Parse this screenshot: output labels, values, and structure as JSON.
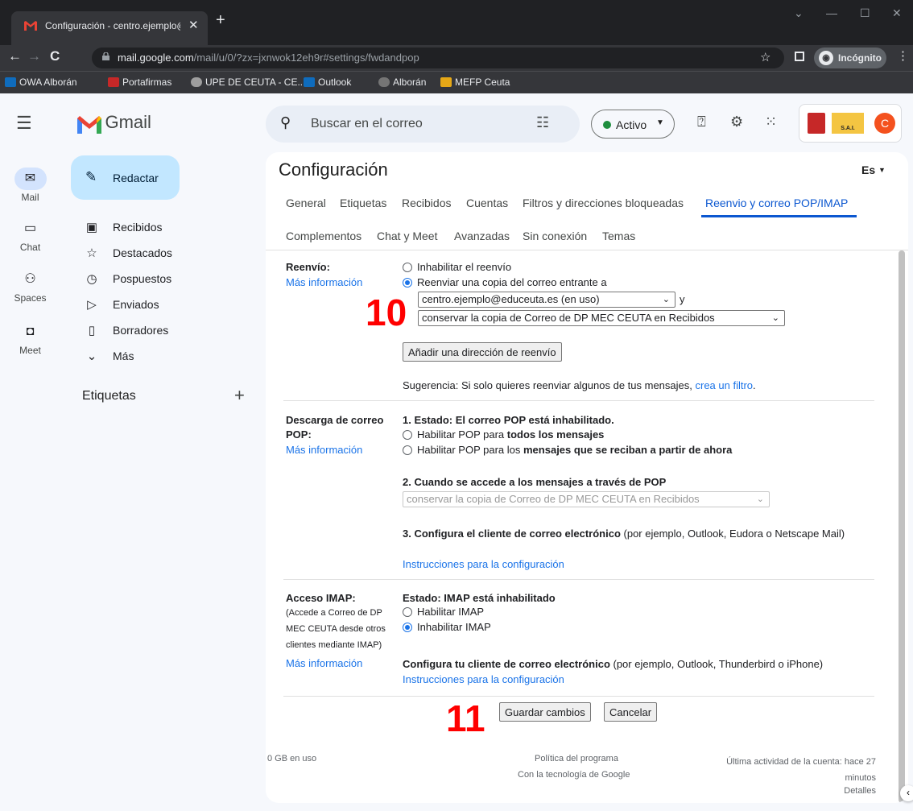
{
  "browser": {
    "tab_title": "Configuración - centro.ejemplo@",
    "url_host": "mail.google.com",
    "url_path": "/mail/u/0/?zx=jxnwok12eh9r#settings/fwdandpop",
    "incognito_label": "Incógnito",
    "bookmarks": [
      {
        "label": "OWA Alborán",
        "color": "#0f6cbd"
      },
      {
        "label": "Portafirmas",
        "color": "#c62828"
      },
      {
        "label": "UPE DE CEUTA - CE...",
        "color": "#9e9e9e"
      },
      {
        "label": "Outlook",
        "color": "#0f6cbd"
      },
      {
        "label": "Alborán",
        "color": "#9e9e9e"
      },
      {
        "label": "MEFP Ceuta",
        "color": "#e6a817"
      }
    ]
  },
  "rail": [
    {
      "label": "Mail"
    },
    {
      "label": "Chat"
    },
    {
      "label": "Spaces"
    },
    {
      "label": "Meet"
    }
  ],
  "app": {
    "name": "Gmail"
  },
  "compose_label": "Redactar",
  "nav": [
    {
      "label": "Recibidos",
      "icon": "inbox-icon"
    },
    {
      "label": "Destacados",
      "icon": "star-icon"
    },
    {
      "label": "Pospuestos",
      "icon": "clock-icon"
    },
    {
      "label": "Enviados",
      "icon": "send-icon"
    },
    {
      "label": "Borradores",
      "icon": "draft-icon"
    },
    {
      "label": "Más",
      "icon": "chevron-down-icon"
    }
  ],
  "labels_heading": "Etiquetas",
  "search_placeholder": "Buscar en el correo",
  "status_label": "Activo",
  "avatar_letter": "C",
  "org_logo_text": "S.A.I.",
  "settings": {
    "title": "Configuración",
    "lang": "Es",
    "tabs_row1": [
      "General",
      "Etiquetas",
      "Recibidos",
      "Cuentas",
      "Filtros y direcciones bloqueadas",
      "Reenvio y correo POP/IMAP"
    ],
    "tabs_row2": [
      "Complementos",
      "Chat y Meet",
      "Avanzadas",
      "Sin conexión",
      "Temas"
    ],
    "forwarding": {
      "label": "Reenvío:",
      "more_info": "Más información",
      "opt_disable": "Inhabilitar el reenvío",
      "opt_forward": "Reenviar una copia del correo entrante a",
      "address": "centro.ejemplo@educeuta.es (en uso)",
      "and": "y",
      "keep_option": "conservar la copia de Correo de DP MEC CEUTA en Recibidos",
      "add_button": "Añadir una dirección de reenvío",
      "tip": "Sugerencia: Si solo quieres reenviar algunos de tus mensajes,",
      "tip_link": "crea un filtro"
    },
    "pop": {
      "label": "Descarga de correo POP:",
      "more_info": "Más información",
      "status": "1. Estado: El correo POP está inhabilitado.",
      "opt_all_pre": "Habilitar POP para ",
      "opt_all_bold": "todos los mensajes",
      "opt_now_pre": "Habilitar POP para los ",
      "opt_now_bold": "mensajes que se reciban a partir de ahora",
      "access_heading": "2. Cuando se accede a los mensajes a través de POP",
      "access_select": "conservar la copia de Correo de DP MEC CEUTA en Recibidos",
      "config_bold": "3. Configura el cliente de correo electrónico",
      "config_rest": " (por ejemplo, Outlook, Eudora o Netscape Mail)",
      "instructions": "Instrucciones para la configuración"
    },
    "imap": {
      "label": "Acceso IMAP:",
      "desc": "(Accede a Correo de DP MEC CEUTA desde otros clientes mediante IMAP)",
      "more_info": "Más información",
      "status": "Estado: IMAP está inhabilitado",
      "opt_enable": "Habilitar IMAP",
      "opt_disable": "Inhabilitar IMAP",
      "config_bold": "Configura tu cliente de correo electrónico",
      "config_rest": " (por ejemplo, Outlook, Thunderbird o iPhone)",
      "instructions": "Instrucciones para la configuración"
    },
    "save_button": "Guardar cambios",
    "cancel_button": "Cancelar",
    "annotation_10": "10",
    "annotation_11": "11"
  },
  "footer": {
    "storage": "0 GB en uso",
    "policy": "Política del programa",
    "powered": "Con la tecnología de Google",
    "activity": "Última actividad de la cuenta: hace 27 minutos",
    "details": "Detalles"
  }
}
